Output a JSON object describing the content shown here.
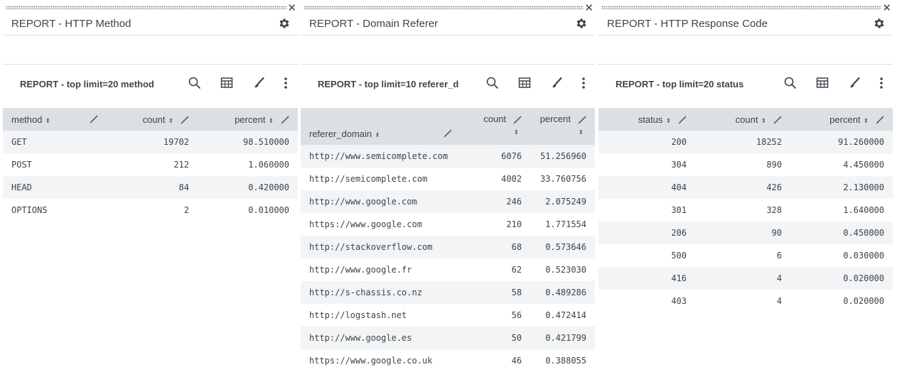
{
  "panels": [
    {
      "title": "REPORT - HTTP Method",
      "viz_title": "REPORT - top limit=20 method",
      "columns": [
        "method",
        "count",
        "percent"
      ],
      "rows": [
        [
          "GET",
          "19702",
          "98.510000"
        ],
        [
          "POST",
          "212",
          "1.060000"
        ],
        [
          "HEAD",
          "84",
          "0.420000"
        ],
        [
          "OPTIONS",
          "2",
          "0.010000"
        ]
      ]
    },
    {
      "title": "REPORT - Domain Referer",
      "viz_title": "REPORT - top limit=10 referer_d",
      "columns": [
        "referer_domain",
        "count",
        "percent"
      ],
      "rows": [
        [
          "http://www.semicomplete.com",
          "6076",
          "51.256960"
        ],
        [
          "http://semicomplete.com",
          "4002",
          "33.760756"
        ],
        [
          "http://www.google.com",
          "246",
          "2.075249"
        ],
        [
          "https://www.google.com",
          "210",
          "1.771554"
        ],
        [
          "http://stackoverflow.com",
          "68",
          "0.573646"
        ],
        [
          "http://www.google.fr",
          "62",
          "0.523030"
        ],
        [
          "http://s-chassis.co.nz",
          "58",
          "0.489286"
        ],
        [
          "http://logstash.net",
          "56",
          "0.472414"
        ],
        [
          "http://www.google.es",
          "50",
          "0.421799"
        ],
        [
          "https://www.google.co.uk",
          "46",
          "0.388055"
        ]
      ]
    },
    {
      "title": "REPORT - HTTP Response Code",
      "viz_title": "REPORT - top limit=20 status",
      "columns": [
        "status",
        "count",
        "percent"
      ],
      "rows": [
        [
          "200",
          "18252",
          "91.260000"
        ],
        [
          "304",
          "890",
          "4.450000"
        ],
        [
          "404",
          "426",
          "2.130000"
        ],
        [
          "301",
          "328",
          "1.640000"
        ],
        [
          "206",
          "90",
          "0.450000"
        ],
        [
          "500",
          "6",
          "0.030000"
        ],
        [
          "416",
          "4",
          "0.020000"
        ],
        [
          "403",
          "4",
          "0.020000"
        ]
      ]
    }
  ]
}
